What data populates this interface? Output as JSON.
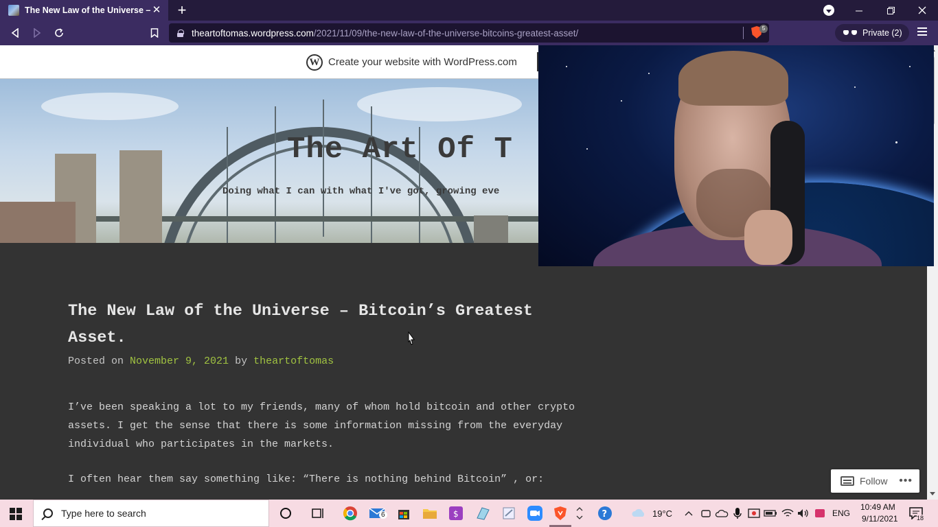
{
  "browser": {
    "tab_title": "The New Law of the Universe – Bi",
    "tab_close": "✕",
    "new_tab": "+",
    "url_host": "theartoftomas.wordpress.com",
    "url_path": "/2021/11/09/the-new-law-of-the-universe-bitcoins-greatest-asset/",
    "shield_count": "5",
    "private_label": "Private (2)"
  },
  "wordpress_bar": {
    "logo_letter": "W",
    "text": "Create your website with WordPress.com"
  },
  "site": {
    "title": "The Art Of T",
    "tagline": "Doing what I can with what I've got, growing eve"
  },
  "post": {
    "title": "The New Law of the Universe – Bitcoin’s Greatest Asset.",
    "posted_on": "Posted on",
    "date": "November 9, 2021",
    "by": "by",
    "author": "theartoftomas",
    "paragraphs": [
      "I’ve been speaking a lot to my friends, many of whom hold bitcoin and other crypto assets. I get the sense that there is some information missing from the everyday individual who participates in the markets.",
      "I often hear them say something like: “There is nothing behind Bitcoin” , or:"
    ]
  },
  "follow": {
    "label": "Follow",
    "more": "•••"
  },
  "taskbar": {
    "search_placeholder": "Type here to search",
    "mail_badge": "6",
    "weather": "19°C",
    "language": "ENG",
    "time": "10:49 AM",
    "date": "9/11/2021",
    "notifications": "18"
  },
  "colors": {
    "accent_link": "#a1c341",
    "browser_bg": "#3b2c61",
    "page_bg": "#333333"
  }
}
